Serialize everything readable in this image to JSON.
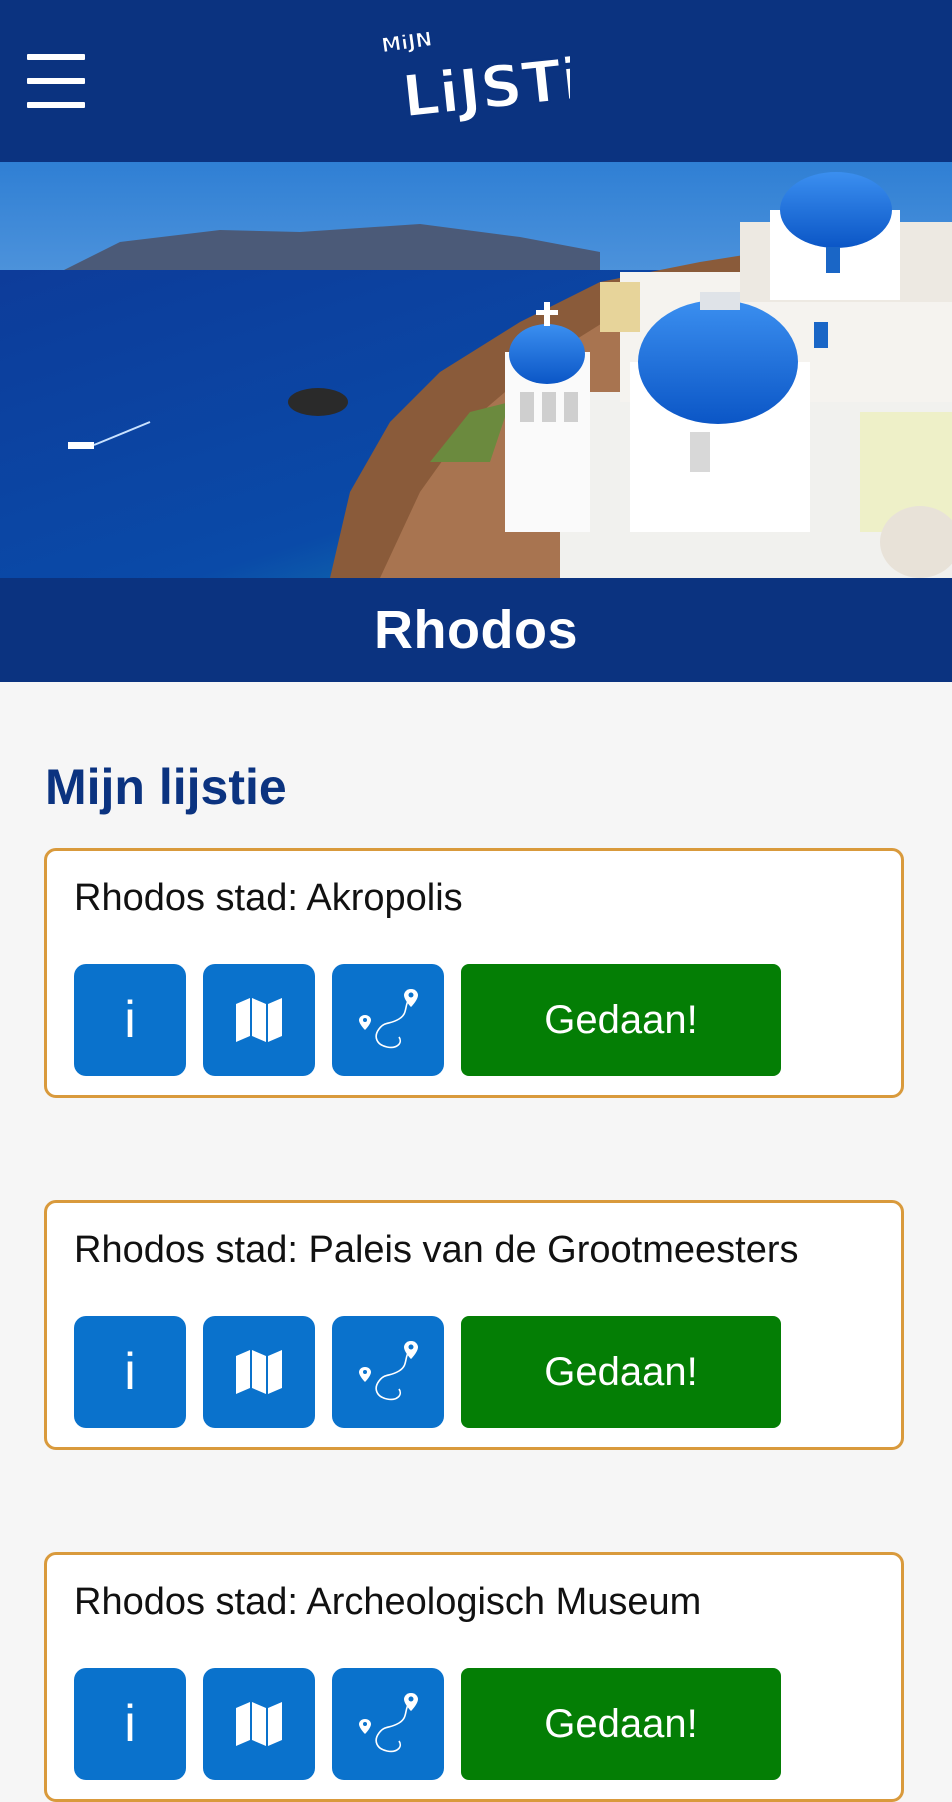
{
  "header": {
    "menu_icon": "hamburger-icon",
    "logo_alt": "Mijn Lijstje"
  },
  "page": {
    "title": "Rhodos"
  },
  "section": {
    "title": "Mijn lijstie"
  },
  "items": [
    {
      "title": "Rhodos stad: Akropolis",
      "info_label": "i",
      "done_label": "Gedaan!"
    },
    {
      "title": "Rhodos stad: Paleis van de Grootmeesters",
      "info_label": "i",
      "done_label": "Gedaan!"
    },
    {
      "title": "Rhodos stad: Archeologisch Museum",
      "info_label": "i",
      "done_label": "Gedaan!"
    }
  ],
  "colors": {
    "header_bg": "#0b3380",
    "accent_blue": "#0a72cc",
    "done_green": "#047e05",
    "card_border": "#d99a3c"
  }
}
